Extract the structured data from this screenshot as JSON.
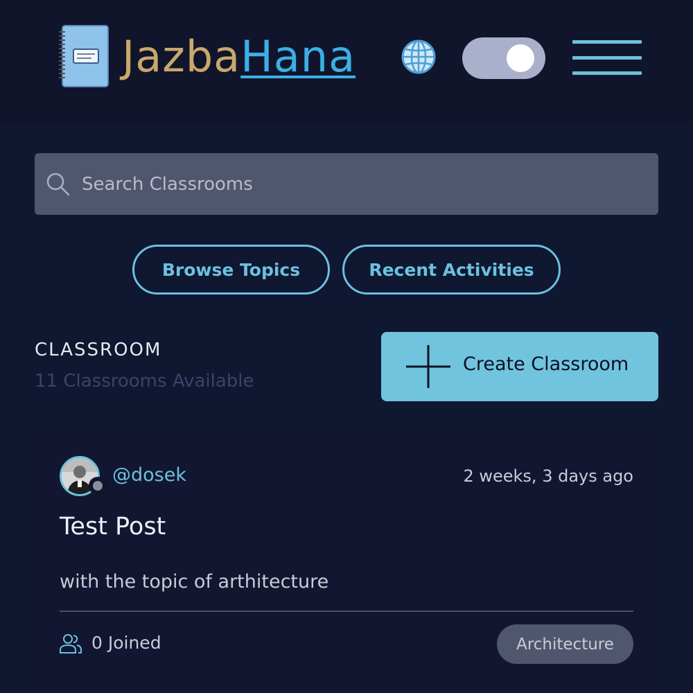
{
  "header": {
    "logo_part1": "Jazba",
    "logo_part2": "Hana",
    "language_icon": "globe-icon",
    "theme_toggle_icon": "toggle-icon",
    "menu_icon": "hamburger-menu-icon"
  },
  "search": {
    "placeholder": "Search Classrooms",
    "value": "",
    "icon": "search-icon"
  },
  "nav_buttons": {
    "browse_topics": "Browse Topics",
    "recent_activities": "Recent Activities"
  },
  "classroom_section": {
    "title": "CLASSROOM",
    "subtitle": "11 Classrooms Available",
    "create_button_label": "Create Classroom",
    "create_button_icon": "plus-icon"
  },
  "posts": [
    {
      "username": "@dosek",
      "timestamp": "2 weeks, 3 days ago",
      "title": "Test Post",
      "description": "with the topic of arthitecture",
      "joined": "0 Joined",
      "topic_tag": "Architecture",
      "status": "offline"
    }
  ],
  "colors": {
    "page_bg": "#0f1731",
    "header_bg": "#11152b",
    "accent": "#6cc1dd",
    "logo_gold": "#c8a86b",
    "logo_blue": "#3bb0e6",
    "card_bg": "#121631",
    "input_bg": "#51566f"
  }
}
